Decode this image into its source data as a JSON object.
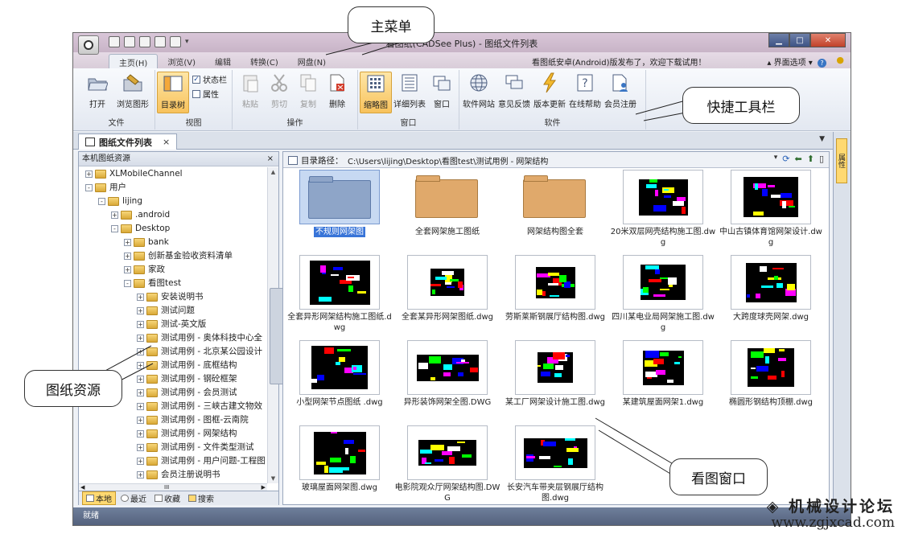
{
  "window": {
    "title": "看图纸(CADSee Plus) - 图纸文件列表",
    "notice": "看图纸安卓(Android)版发布了，欢迎下载试用！",
    "view_options": "界面选项",
    "help_glyph": "?"
  },
  "menu_tabs": [
    {
      "label": "主页(H)"
    },
    {
      "label": "浏览(V)"
    },
    {
      "label": "编辑"
    },
    {
      "label": "转换(C)"
    },
    {
      "label": "网盘(N)"
    }
  ],
  "ribbon": {
    "file": {
      "label": "文件",
      "open": "打开",
      "browse": "浏览图形"
    },
    "view": {
      "label": "视图",
      "tree": "目录树",
      "statusbar": "状态栏",
      "props": "属性"
    },
    "ops": {
      "label": "操作",
      "paste": "粘贴",
      "cut": "剪切",
      "copy": "复制",
      "delete": "删除"
    },
    "window": {
      "label": "窗口",
      "thumb": "缩略图",
      "detail": "详细列表",
      "win": "窗口"
    },
    "software": {
      "label": "软件",
      "site": "软件网站",
      "feedback": "意见反馈",
      "update": "版本更新",
      "help": "在线帮助",
      "register": "会员注册"
    }
  },
  "doc_tab": {
    "label": "图纸文件列表",
    "close": "×"
  },
  "left_panel": {
    "title": "本机图纸资源",
    "close": "×",
    "tree": [
      {
        "label": "XLMobileChannel",
        "level": 0,
        "toggle": "+"
      },
      {
        "label": "用户",
        "level": 0,
        "toggle": "-"
      },
      {
        "label": "lijing",
        "level": 1,
        "toggle": "-"
      },
      {
        "label": ".android",
        "level": 2,
        "toggle": "+"
      },
      {
        "label": "Desktop",
        "level": 2,
        "toggle": "-"
      },
      {
        "label": "bank",
        "level": 3,
        "toggle": "+"
      },
      {
        "label": "创新基金验收资料清单",
        "level": 3,
        "toggle": "+"
      },
      {
        "label": "家政",
        "level": 3,
        "toggle": "+"
      },
      {
        "label": "看图test",
        "level": 3,
        "toggle": "-"
      },
      {
        "label": "安装说明书",
        "level": 4,
        "toggle": "+"
      },
      {
        "label": "测试问题",
        "level": 4,
        "toggle": "+"
      },
      {
        "label": "测试-英文版",
        "level": 4,
        "toggle": "+"
      },
      {
        "label": "测试用例 - 奥体科技中心全",
        "level": 4,
        "toggle": "+"
      },
      {
        "label": "测试用例 - 北京某公园设计",
        "level": 4,
        "toggle": "+"
      },
      {
        "label": "测试用例 - 底框结构",
        "level": 4,
        "toggle": "+"
      },
      {
        "label": "测试用例 - 钢砼框架",
        "level": 4,
        "toggle": "+"
      },
      {
        "label": "测试用例 - 会员测试",
        "level": 4,
        "toggle": "+"
      },
      {
        "label": "测试用例 - 三峡古建文物效",
        "level": 4,
        "toggle": "+"
      },
      {
        "label": "测试用例 - 图框-云南院",
        "level": 4,
        "toggle": "+"
      },
      {
        "label": "测试用例 - 网架结构",
        "level": 4,
        "toggle": "+"
      },
      {
        "label": "测试用例 - 文件类型测试",
        "level": 4,
        "toggle": "+"
      },
      {
        "label": "测试用例 - 用户问题-工程图",
        "level": 4,
        "toggle": "+"
      },
      {
        "label": "会员注册说明书",
        "level": 4,
        "toggle": "+"
      }
    ],
    "bottom_tabs": [
      {
        "label": "本地"
      },
      {
        "label": "最近"
      },
      {
        "label": "收藏"
      },
      {
        "label": "搜索"
      }
    ],
    "scroll_mark": "III"
  },
  "right_panel": {
    "path_label": "目录路径：",
    "path": "C:\\Users\\lijing\\Desktop\\看图test\\测试用例 - 网架结构",
    "files": [
      {
        "name": "不规则网架图",
        "type": "folder",
        "selected": true
      },
      {
        "name": "全套网架施工图纸",
        "type": "folder"
      },
      {
        "name": "网架结构图全套",
        "type": "folder"
      },
      {
        "name": "20米双层网壳结构施工图.dwg",
        "type": "dwg"
      },
      {
        "name": "中山古镇体育馆网架设计.dwg",
        "type": "dwg"
      },
      {
        "name": "全套异形网架结构施工图纸.dwg",
        "type": "dwg"
      },
      {
        "name": "全套某异形网架图纸.dwg",
        "type": "dwg"
      },
      {
        "name": "劳斯莱斯钢展厅结构图.dwg",
        "type": "dwg"
      },
      {
        "name": "四川某电业局网架施工图.dwg",
        "type": "dwg"
      },
      {
        "name": "大跨度球壳网架.dwg",
        "type": "dwg"
      },
      {
        "name": "小型网架节点图纸 .dwg",
        "type": "dwg"
      },
      {
        "name": "异形装饰网架全图.DWG",
        "type": "dwg"
      },
      {
        "name": "某工厂网架设计施工图.dwg",
        "type": "dwg"
      },
      {
        "name": "某建筑屋面网架1.dwg",
        "type": "dwg"
      },
      {
        "name": "椭圆形钢结构顶棚.dwg",
        "type": "dwg"
      },
      {
        "name": "玻璃屋面网架图.dwg",
        "type": "dwg"
      },
      {
        "name": "电影院观众厅网架结构图.DWG",
        "type": "dwg"
      },
      {
        "name": "长安汽车带夹层钢展厅结构图.dwg",
        "type": "dwg"
      }
    ]
  },
  "side_strip": {
    "label": "属性"
  },
  "status": {
    "text": "就绪"
  },
  "callouts": {
    "main_menu": "主菜单",
    "toolbar": "快捷工具栏",
    "resources": "图纸资源",
    "viewer": "看图窗口"
  },
  "watermark": {
    "line1": "机械设计论坛",
    "line2": "www.zgjxcad.com"
  },
  "colors": {
    "accent": "#3874d8",
    "folder": "#e0a96b",
    "selected_folder": "#8ea5c8",
    "status_bar": "#5f6e89"
  }
}
